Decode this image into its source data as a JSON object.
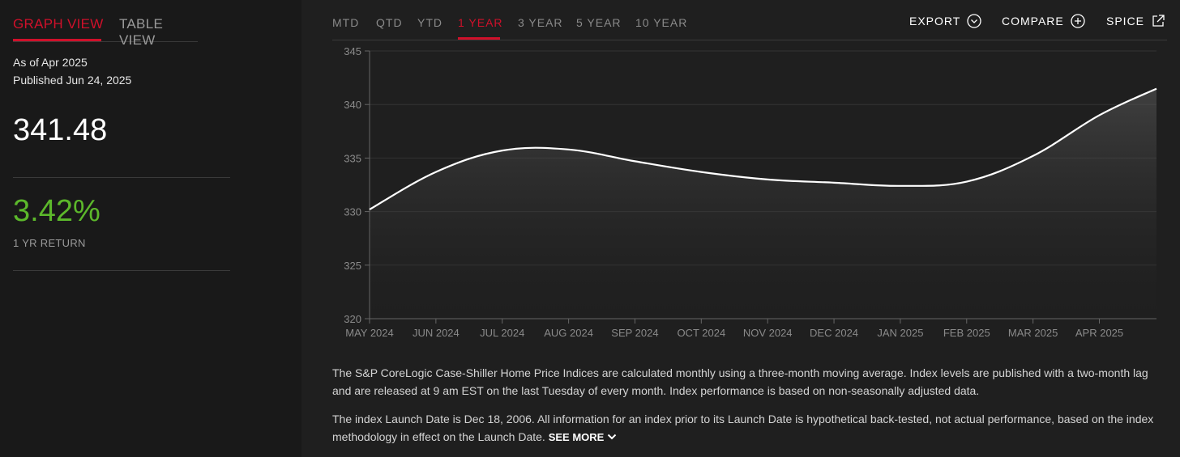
{
  "sidebar": {
    "tabs": [
      "GRAPH VIEW",
      "TABLE VIEW"
    ],
    "as_of": "As of Apr 2025",
    "published": "Published Jun 24, 2025",
    "value": "341.48",
    "return_value": "3.42%",
    "return_label": "1 YR RETURN"
  },
  "toolbar": {
    "ranges": [
      "MTD",
      "QTD",
      "YTD",
      "1 YEAR",
      "3 YEAR",
      "5 YEAR",
      "10 YEAR"
    ],
    "active_range": "1 YEAR",
    "export_label": "EXPORT",
    "compare_label": "COMPARE",
    "spice_label": "SPICE"
  },
  "description": {
    "para1": "The S&P CoreLogic Case-Shiller Home Price Indices are calculated monthly using a three-month moving average. Index levels are published with a two-month lag and are released at 9 am EST on the last Tuesday of every month. Index performance is based on non-seasonally adjusted data.",
    "para2": "The index Launch Date is Dec 18, 2006. All information for an index prior to its Launch Date is hypothetical back-tested, not actual performance, based on the index methodology in effect on the Launch Date.",
    "see_more": "SEE MORE"
  },
  "colors": {
    "accent": "#d0102a",
    "positive": "#5cb82b",
    "line": "#ffffff"
  },
  "chart_data": {
    "type": "area",
    "x": [
      "MAY 2024",
      "JUN 2024",
      "JUL 2024",
      "AUG 2024",
      "SEP 2024",
      "OCT 2024",
      "NOV 2024",
      "DEC 2024",
      "JAN 2025",
      "FEB 2025",
      "MAR 2025",
      "APR 2025"
    ],
    "series": [
      {
        "values": [
          330.2,
          333.7,
          335.7,
          335.8,
          334.7,
          333.7,
          333.0,
          332.7,
          332.4,
          332.8,
          335.2,
          339.0,
          341.48
        ]
      }
    ],
    "ylim": [
      320,
      345
    ],
    "yticks": [
      "320",
      "325",
      "330",
      "335",
      "340",
      "345"
    ],
    "grid": true
  }
}
